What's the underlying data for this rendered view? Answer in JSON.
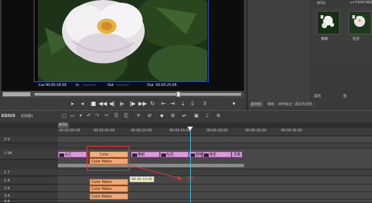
{
  "app": {
    "name": "EDIUS",
    "project_title": "无标题1",
    "bin_path": "序列1"
  },
  "viewer": {
    "cur_label": "Cur",
    "cur_value": "00:00:18:06",
    "in_label": "In",
    "in_value": "--:--:--:--",
    "out_label": "Out",
    "out_value": "--:--:--:--",
    "dur_label": "Dur",
    "dur_value": "00:00:25:06"
  },
  "bin": {
    "header": "序列1",
    "seq_id": "u=74097462",
    "clips": [
      {
        "label": "茉莉"
      },
      {
        "label": "牡丹"
      }
    ],
    "properties_label": "属性",
    "value_label": "值",
    "tabs": [
      "素材库",
      "特效",
      "序列标记",
      "源文件浏览"
    ]
  },
  "timeline": {
    "sequence_tab": "序列1",
    "ruler": [
      "00:00:00:00",
      "00:00:05:00",
      "00:00:10:00",
      "00:00:15:00",
      "00:00:20:00",
      "00:00:25:00",
      "00:00:30:00"
    ],
    "tracks": [
      {
        "id": "1V",
        "label": "1 VA"
      },
      {
        "id": "2V",
        "label": "2 V"
      },
      {
        "id": "1T",
        "label": "1 T"
      },
      {
        "id": "1A",
        "label": "1 A"
      },
      {
        "id": "2A",
        "label": "2 A"
      },
      {
        "id": "3A",
        "label": "3 A"
      },
      {
        "id": "4A",
        "label": "4 A"
      }
    ],
    "video_clips": [
      "白兰",
      "Color ...",
      "菜莉",
      "牡丹",
      "腊梅",
      "桂花",
      "百合",
      "月季"
    ],
    "color_matte_clips": [
      "Color Matte",
      "Color Matte",
      "Color Matte",
      "Color Matte"
    ],
    "tooltip": "00:00:10:00",
    "annotation": "拉长"
  }
}
